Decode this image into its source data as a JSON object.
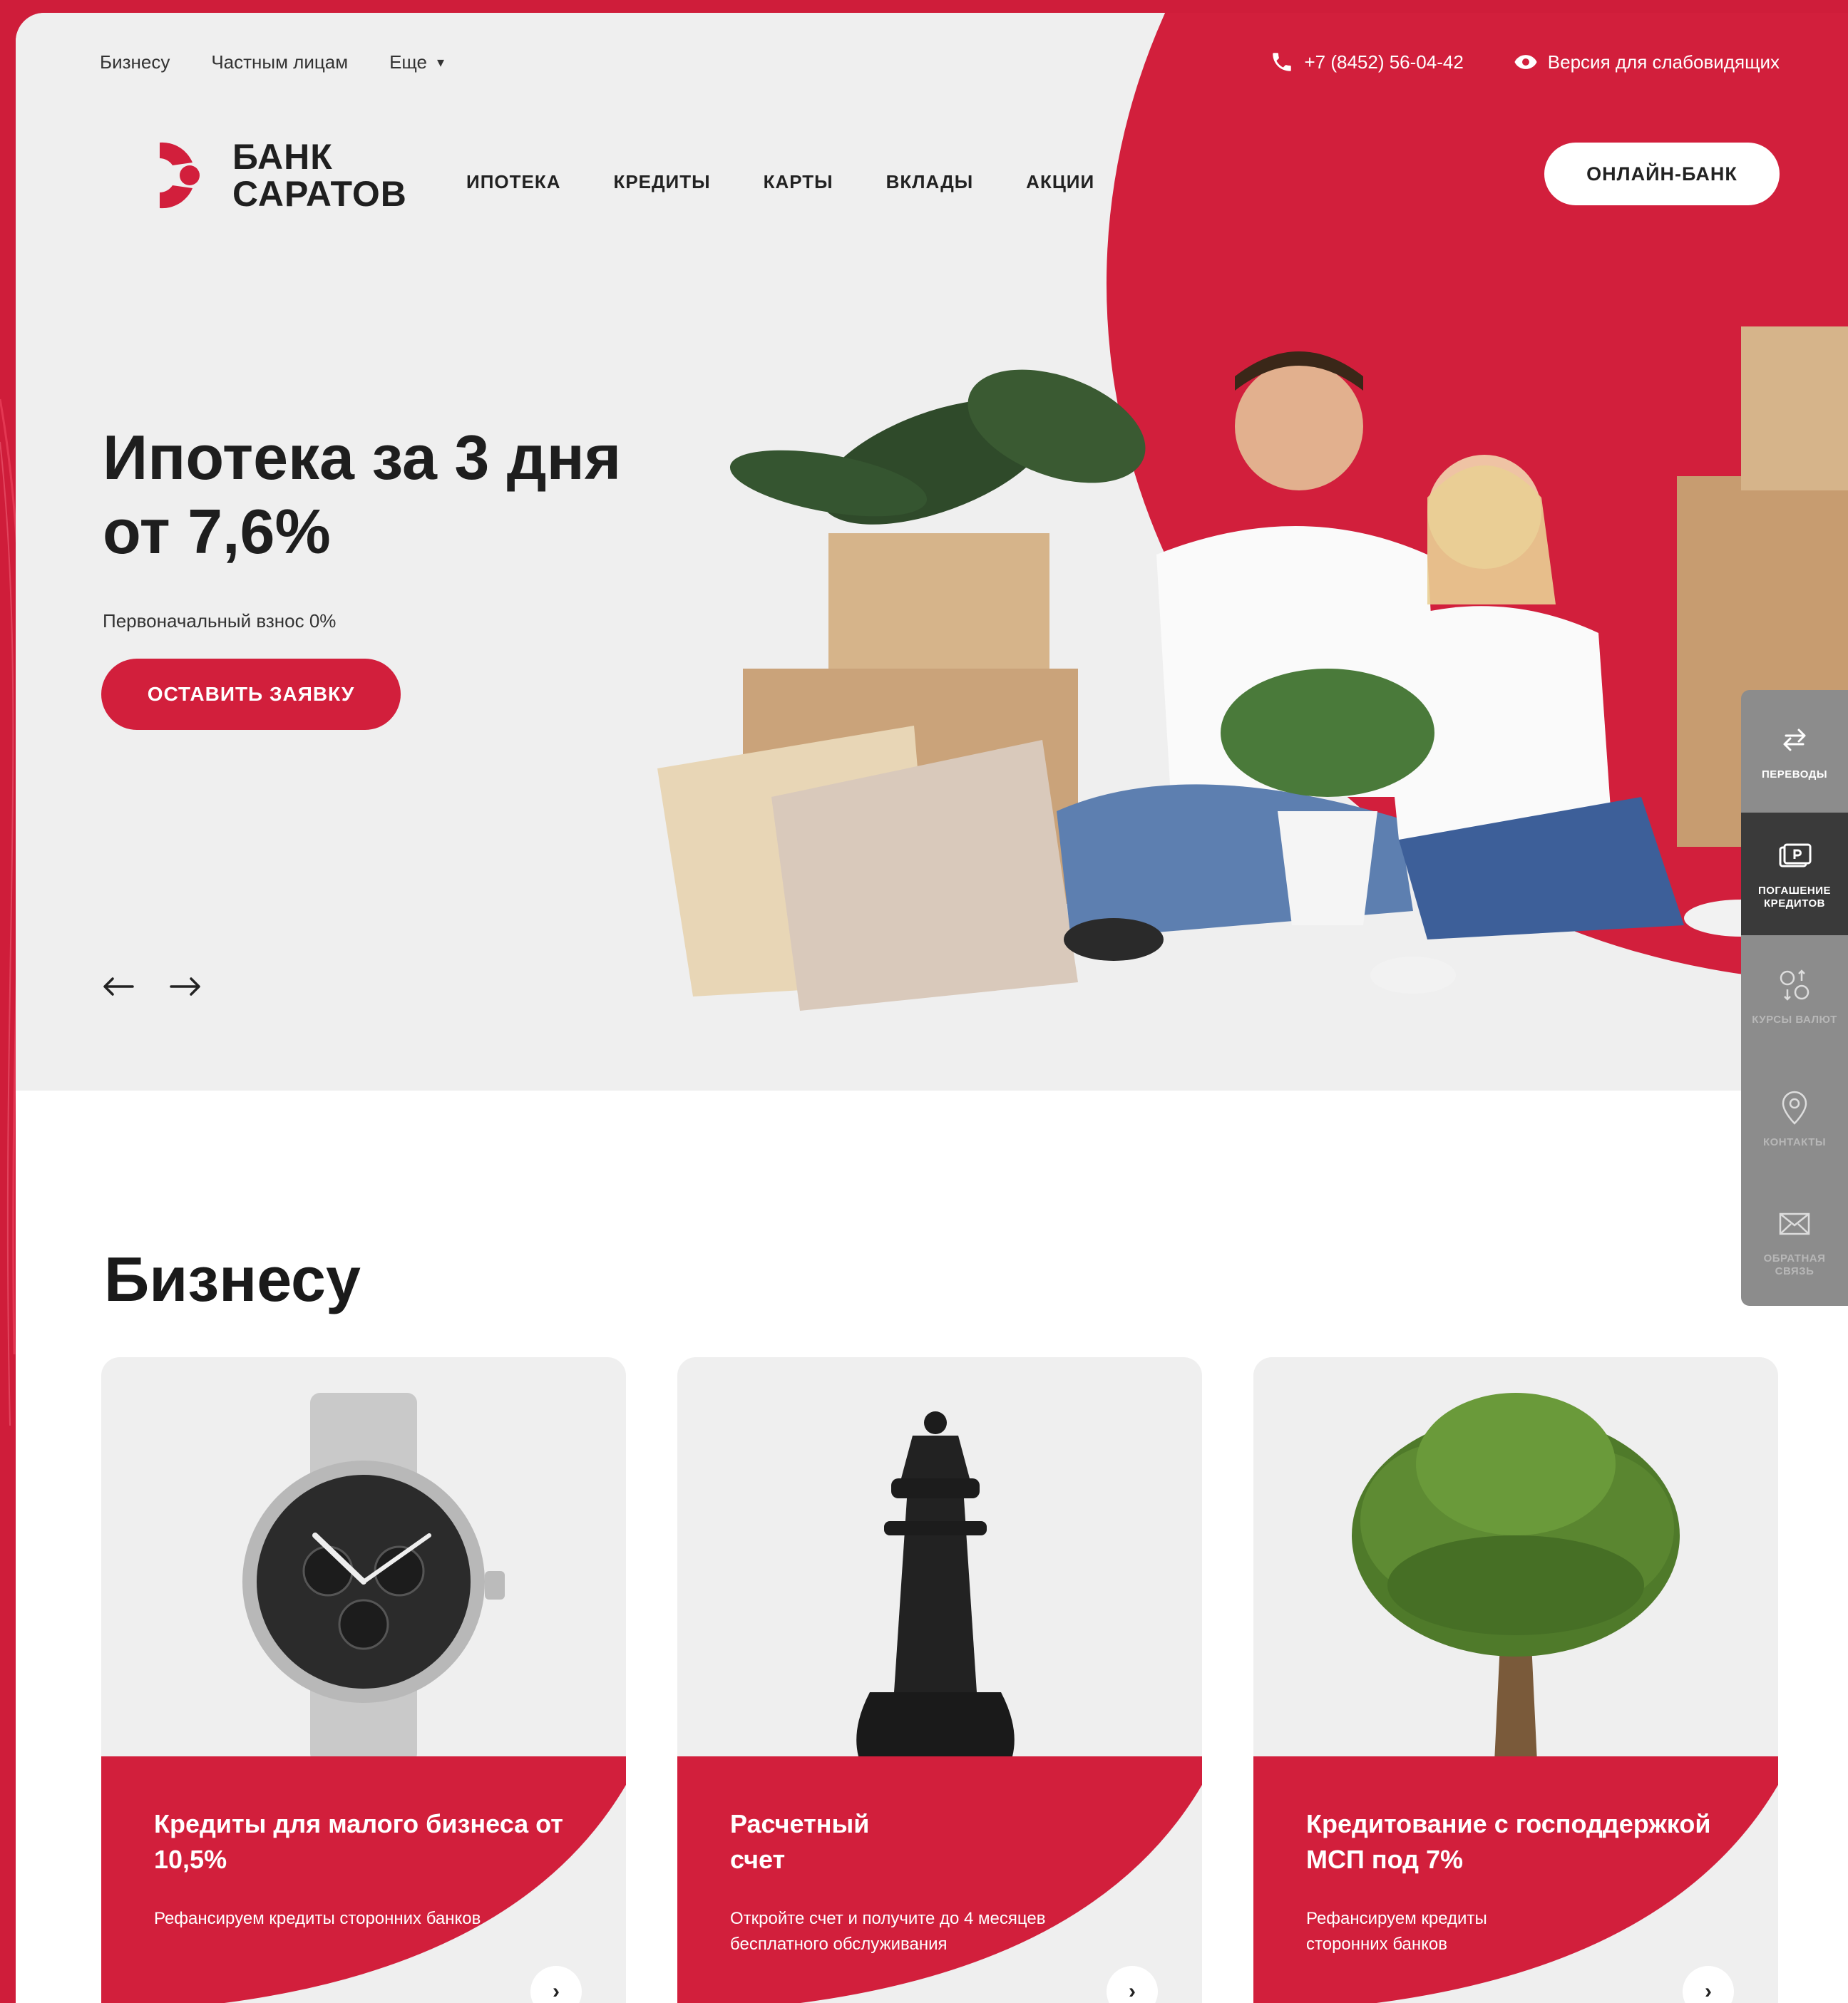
{
  "topbar": {
    "links": [
      "Бизнесу",
      "Частным лицам",
      "Еще"
    ],
    "phone": "+7 (8452) 56-04-42",
    "accessibility": "Версия для слабовидящих"
  },
  "logo": {
    "line1": "БАНК",
    "line2": "САРАТОВ"
  },
  "nav": [
    "ИПОТЕКА",
    "КРЕДИТЫ",
    "КАРТЫ",
    "ВКЛАДЫ",
    "АКЦИИ"
  ],
  "online_bank": "ОНЛАЙН-БАНК",
  "hero": {
    "title_line1": "Ипотека за 3 дня",
    "title_line2": "от 7,6%",
    "subtitle": "Первоначальный взнос 0%",
    "cta": "ОСТАВИТЬ ЗАЯВКУ"
  },
  "side_panel": [
    {
      "label": "ПЕРЕВОДЫ",
      "icon": "transfer-icon"
    },
    {
      "label": "ПОГАШЕНИЕ\nКРЕДИТОВ",
      "icon": "payment-icon"
    },
    {
      "label": "КУРСЫ ВАЛЮТ",
      "icon": "currency-icon"
    },
    {
      "label": "КОНТАКТЫ",
      "icon": "location-icon"
    },
    {
      "label": "ОБРАТНАЯ\nСВЯЗЬ",
      "icon": "envelope-icon"
    }
  ],
  "business": {
    "title": "Бизнесу",
    "cards": [
      {
        "title": "Кредиты для малого бизнеса от 10,5%",
        "desc": "Рефансируем кредиты сторонних банков"
      },
      {
        "title": "Расчетный счет",
        "desc": "Откройте счет и получите до 4 месяцев бесплатного обслуживания"
      },
      {
        "title": "Кредитование с господдержкой МСП под 7%",
        "desc": "Рефансируем кредиты сторонних банков"
      }
    ]
  },
  "colors": {
    "brand_red": "#d21f3c",
    "hero_bg": "#efefef",
    "text_dark": "#1e1e1e"
  }
}
